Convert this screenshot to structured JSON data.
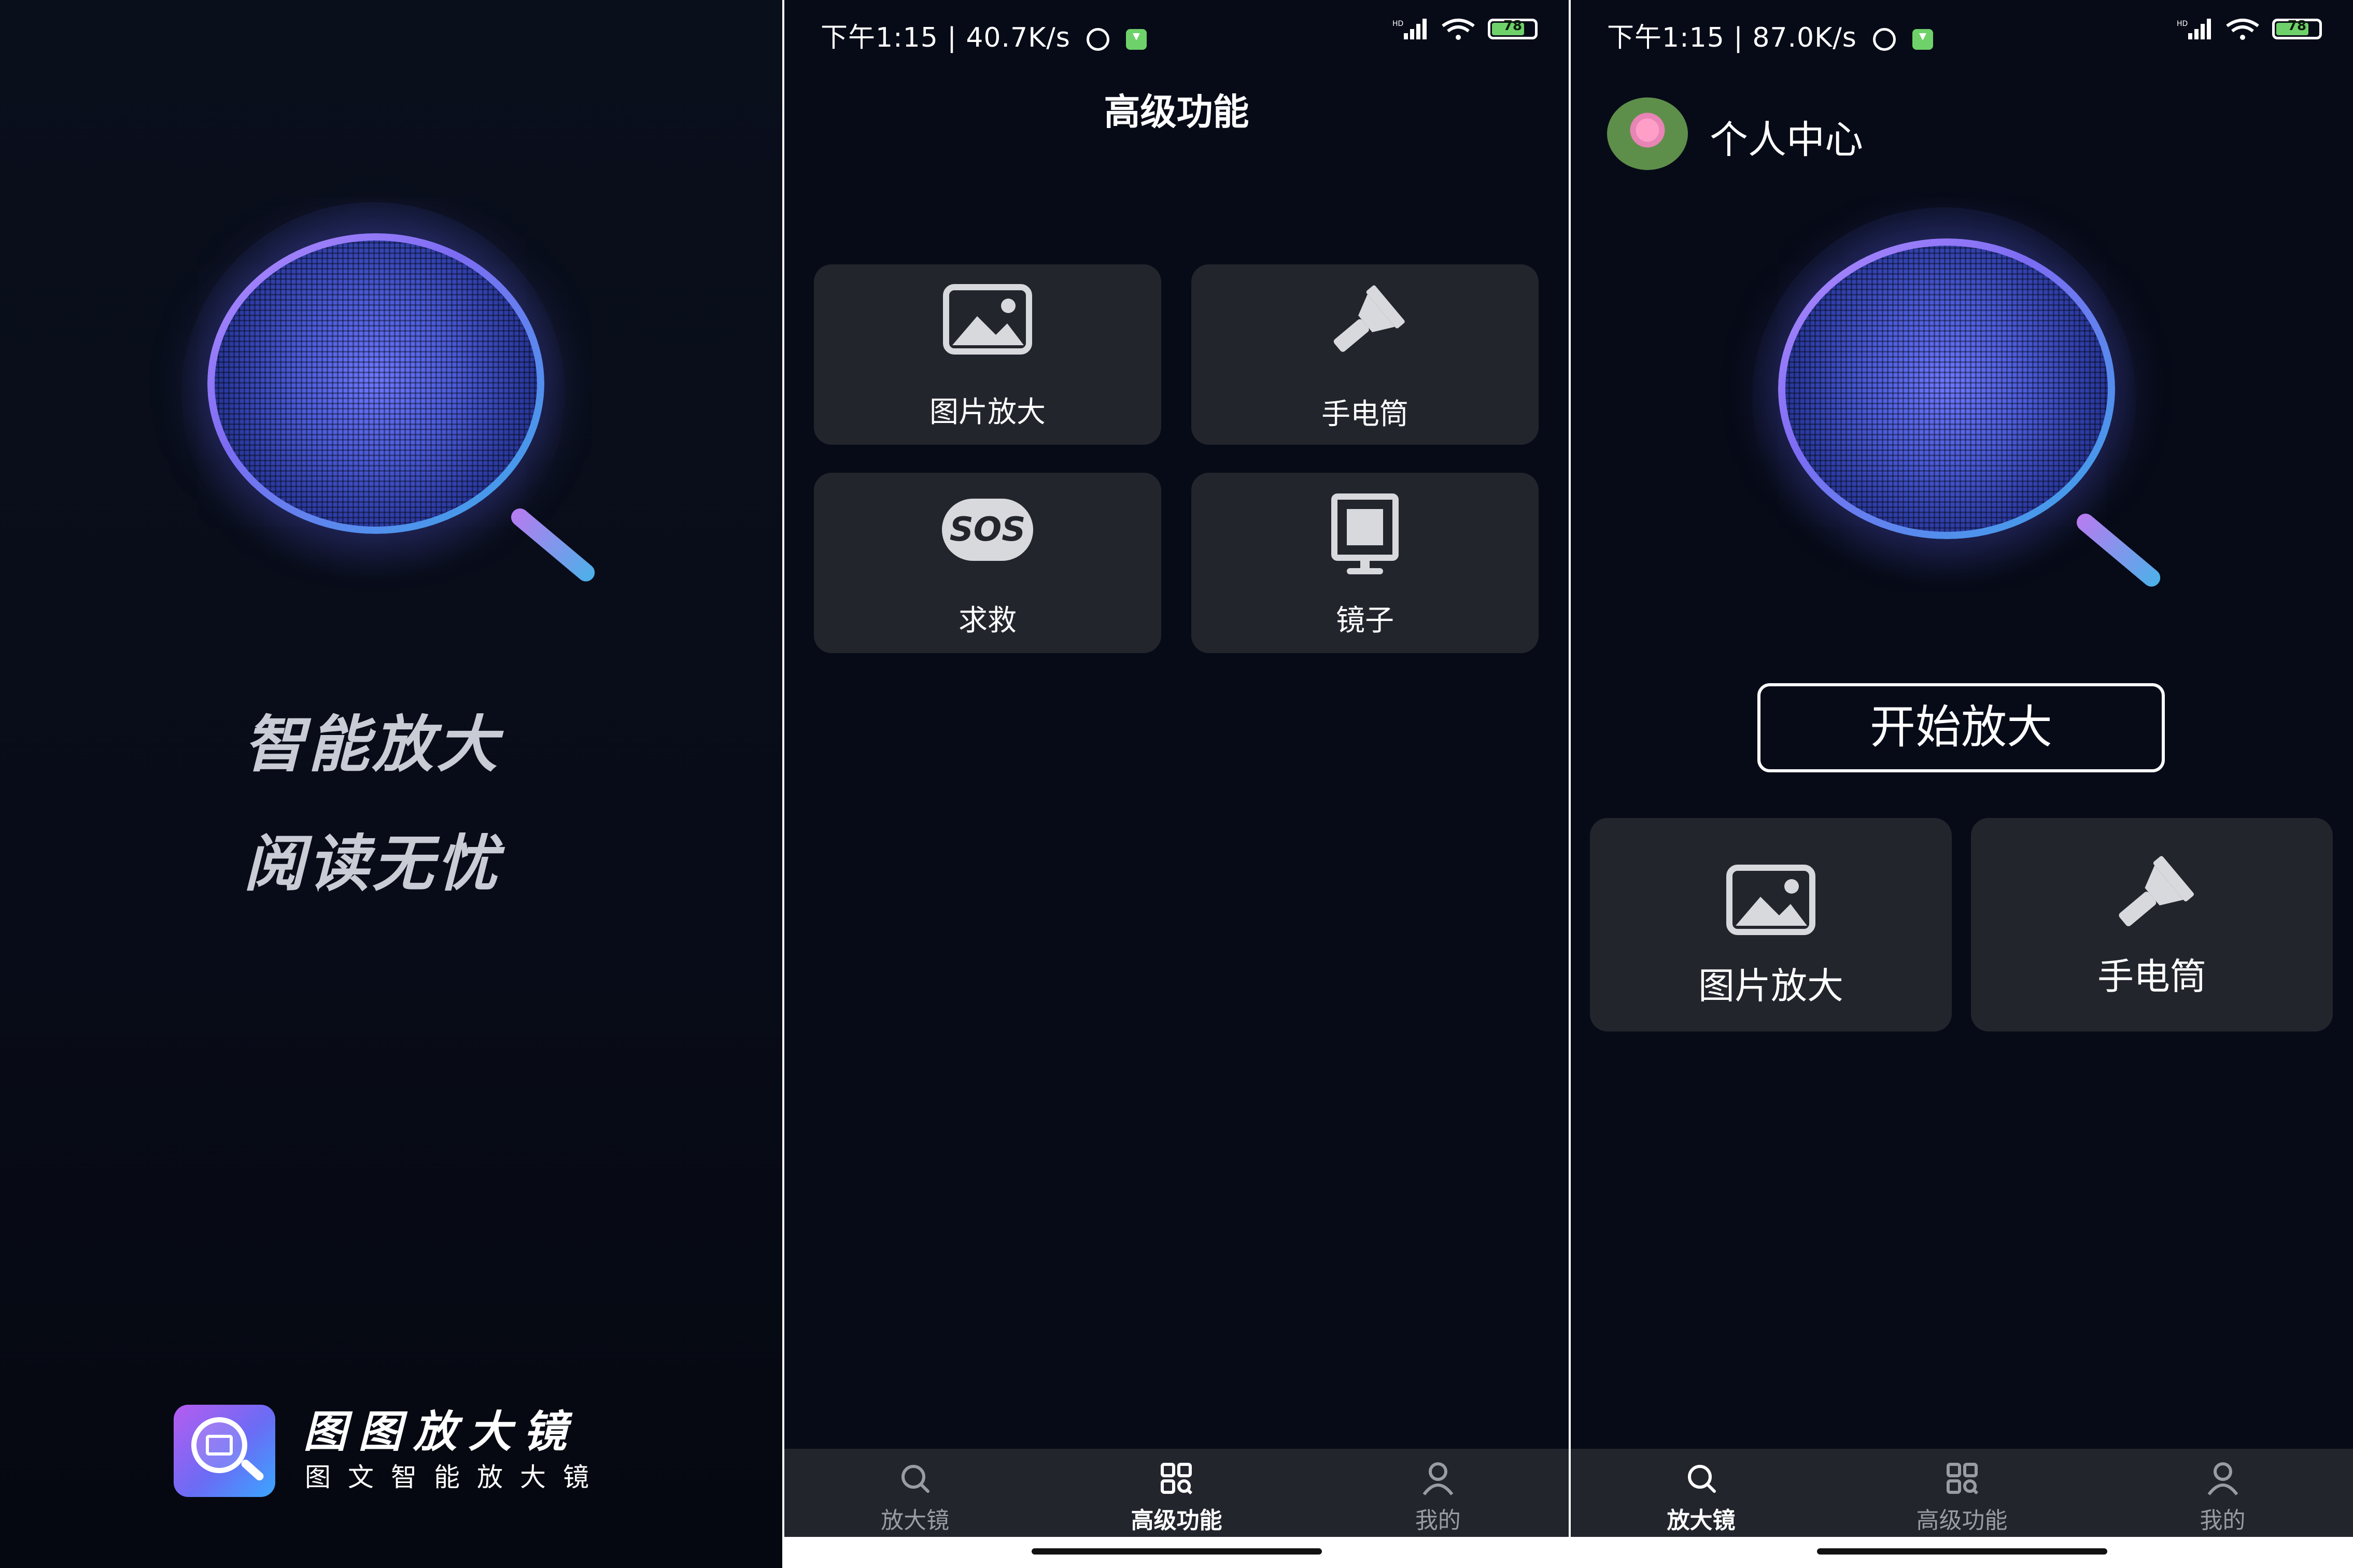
{
  "splash": {
    "slogan_line1": "智能放大",
    "slogan_line2": "阅读无忧",
    "brand_name": "图图放大镜",
    "brand_subtitle": "图文智能放大镜"
  },
  "advanced": {
    "status_time": "下午1:15 | 40.7K/s",
    "battery": "78",
    "title": "高级功能",
    "cards": [
      {
        "label": "图片放大",
        "icon": "image-icon"
      },
      {
        "label": "手电筒",
        "icon": "flashlight-icon"
      },
      {
        "label": "求救",
        "icon": "sos-icon"
      },
      {
        "label": "镜子",
        "icon": "mirror-icon"
      }
    ],
    "sos_text": "SOS"
  },
  "home": {
    "status_time": "下午1:15 | 87.0K/s",
    "battery": "78",
    "profile_label": "个人中心",
    "start_button": "开始放大",
    "cards": [
      {
        "label": "图片放大",
        "icon": "image-icon"
      },
      {
        "label": "手电筒",
        "icon": "flashlight-icon"
      }
    ]
  },
  "nav": {
    "tabs": [
      {
        "label": "放大镜",
        "icon": "search-icon"
      },
      {
        "label": "高级功能",
        "icon": "grid-icon"
      },
      {
        "label": "我的",
        "icon": "user-icon"
      }
    ]
  },
  "colors": {
    "background": "#070b17",
    "card": "#23252d",
    "accent_purple": "#b48cff",
    "accent_blue": "#35a8e8",
    "battery_green": "#6fd16a"
  }
}
